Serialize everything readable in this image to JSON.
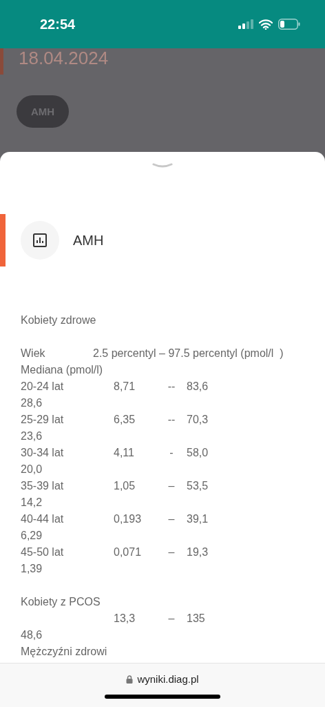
{
  "status_bar": {
    "time": "22:54"
  },
  "background": {
    "date": "18.04.2024",
    "chip": "AMH"
  },
  "sheet": {
    "title": "AMH",
    "healthy_women": {
      "title": "Kobiety zdrowe",
      "age_header": "Wiek",
      "range_header": "2.5 percentyl – 97.5 percentyl (pmol/l  )",
      "median_header": "Mediana (pmol/l)",
      "rows": [
        {
          "age": "20-24 lat",
          "low": "8,71",
          "sep": "--",
          "high": "83,6",
          "median": "28,6"
        },
        {
          "age": "25-29 lat",
          "low": "6,35",
          "sep": "--",
          "high": "70,3",
          "median": "23,6"
        },
        {
          "age": "30-34 lat",
          "low": "4,11",
          "sep": "-",
          "high": "58,0",
          "median": "20,0"
        },
        {
          "age": "35-39 lat",
          "low": "1,05",
          "sep": "–",
          "high": "53,5",
          "median": "14,2"
        },
        {
          "age": "40-44 lat",
          "low": "0,193",
          "sep": "–",
          "high": "39,1",
          "median": "6,29"
        },
        {
          "age": "45-50 lat",
          "low": "0,071",
          "sep": "–",
          "high": "19,3",
          "median": "1,39"
        }
      ]
    },
    "pcos": {
      "title": "Kobiety z PCOS",
      "low": "13,3",
      "sep": "–",
      "high": "135",
      "median": "48,6"
    },
    "healthy_men": {
      "title": "Mężczyźni zdrowi"
    }
  },
  "browser": {
    "url": "wyniki.diag.pl"
  }
}
